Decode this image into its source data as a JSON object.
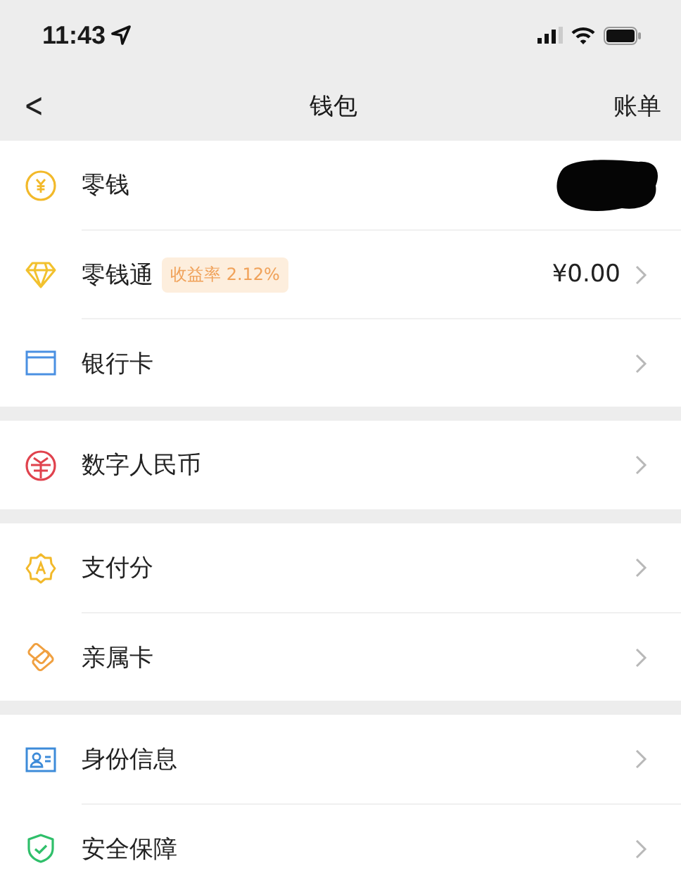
{
  "status_bar": {
    "time": "11:43"
  },
  "nav": {
    "back": "<",
    "title": "钱包",
    "action": "账单"
  },
  "groups": [
    {
      "items": [
        {
          "kind": "coin",
          "label": "零钱",
          "redacted": true
        },
        {
          "kind": "diamond",
          "label": "零钱通",
          "tag": "收益率 2.12%",
          "value": "¥0.00"
        },
        {
          "kind": "card",
          "label": "银行卡"
        }
      ]
    },
    {
      "items": [
        {
          "kind": "ecny",
          "label": "数字人民币"
        }
      ]
    },
    {
      "items": [
        {
          "kind": "badge",
          "label": "支付分"
        },
        {
          "kind": "hearts",
          "label": "亲属卡"
        }
      ]
    },
    {
      "items": [
        {
          "kind": "idcard",
          "label": "身份信息"
        },
        {
          "kind": "shield",
          "label": "安全保障"
        }
      ]
    }
  ]
}
